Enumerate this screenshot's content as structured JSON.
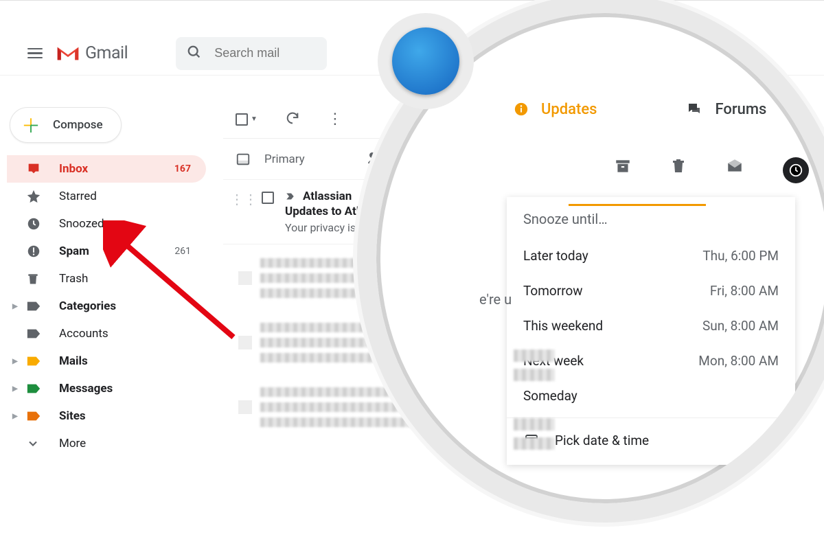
{
  "header": {
    "brand": "Gmail",
    "search_placeholder": "Search mail"
  },
  "sidebar": {
    "compose_label": "Compose",
    "items": [
      {
        "icon": "inbox-icon",
        "label": "Inbox",
        "count": "167",
        "active": true,
        "bold": true
      },
      {
        "icon": "star-icon",
        "label": "Starred",
        "count": "",
        "active": false,
        "bold": false
      },
      {
        "icon": "clock-icon",
        "label": "Snoozed",
        "count": "",
        "active": false,
        "bold": false
      },
      {
        "icon": "spam-icon",
        "label": "Spam",
        "count": "261",
        "active": false,
        "bold": true
      },
      {
        "icon": "trash-icon",
        "label": "Trash",
        "count": "",
        "active": false,
        "bold": false
      },
      {
        "icon": "label-grey",
        "label": "Categories",
        "count": "",
        "active": false,
        "bold": true,
        "expandable": true
      },
      {
        "icon": "label-grey",
        "label": "Accounts",
        "count": "",
        "active": false,
        "bold": false
      },
      {
        "icon": "label-orange",
        "label": "Mails",
        "count": "",
        "active": false,
        "bold": true,
        "expandable": true
      },
      {
        "icon": "label-green",
        "label": "Messages",
        "count": "",
        "active": false,
        "bold": true,
        "expandable": true
      },
      {
        "icon": "label-deeporange",
        "label": "Sites",
        "count": "",
        "active": false,
        "bold": true,
        "expandable": true
      },
      {
        "icon": "chevron-down",
        "label": "More",
        "count": "",
        "active": false,
        "bold": false
      }
    ]
  },
  "tabs": {
    "primary": "Primary"
  },
  "mail": {
    "sender": "Atlassian",
    "subject": "Updates to Atlass",
    "snippet": "Your privacy is im"
  },
  "zoom": {
    "tab_updates": "Updates",
    "tab_forums": "Forums",
    "fragment": "e're u",
    "snooze_title": "Snooze until…",
    "options": [
      {
        "label": "Later today",
        "time": "Thu, 6:00 PM"
      },
      {
        "label": "Tomorrow",
        "time": "Fri, 8:00 AM"
      },
      {
        "label": "This weekend",
        "time": "Sun, 8:00 AM"
      },
      {
        "label": "Next week",
        "time": "Mon, 8:00 AM"
      },
      {
        "label": "Someday",
        "time": ""
      }
    ],
    "pick": "Pick date & time"
  }
}
